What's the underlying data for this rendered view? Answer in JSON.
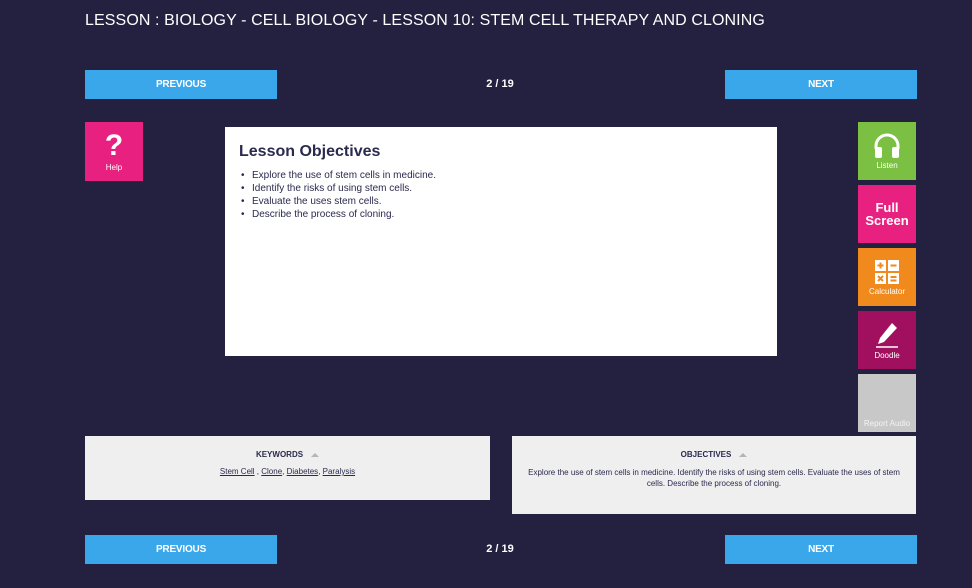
{
  "header": {
    "title": "LESSON : BIOLOGY - CELL BIOLOGY - LESSON 10: STEM CELL THERAPY AND CLONING"
  },
  "nav_top": {
    "previous": "PREVIOUS",
    "counter": "2 / 19",
    "next": "NEXT"
  },
  "nav_bottom": {
    "previous": "PREVIOUS",
    "counter": "2 / 19",
    "next": "NEXT"
  },
  "help": {
    "label": "Help",
    "icon": "question-mark-icon"
  },
  "slide": {
    "title": "Lesson Objectives",
    "bullets": [
      "Explore the use of stem cells in medicine.",
      "Identify the risks of using stem cells.",
      "Evaluate the uses stem cells.",
      "Describe the process of cloning."
    ]
  },
  "tools": {
    "listen": "Listen",
    "full_screen_line1": "Full",
    "full_screen_line2": "Screen",
    "calculator": "Calculator",
    "doodle": "Doodle",
    "report_audio": "Report Audio"
  },
  "keywords": {
    "heading": "KEYWORDS",
    "items": [
      "Stem Cell",
      "Clone",
      "Diabetes",
      "Paralysis"
    ]
  },
  "objectives": {
    "heading": "OBJECTIVES",
    "text": "Explore the use of stem cells in medicine. Identify the risks of using stem cells. Evaluate the uses of stem cells. Describe the process of cloning."
  },
  "colors": {
    "background": "#23213f",
    "nav_blue": "#3aa7ea",
    "help_pink": "#e8207f",
    "listen_green": "#7bc043",
    "calc_orange": "#f08a1c",
    "doodle_purple": "#a1105e",
    "report_grey": "#c8c8c8"
  }
}
